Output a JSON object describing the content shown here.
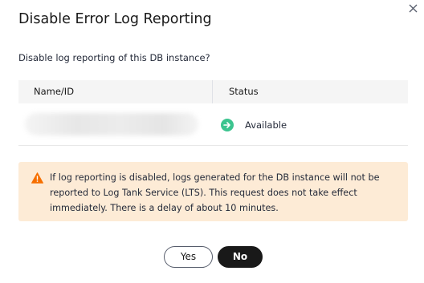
{
  "dialog": {
    "title": "Disable Error Log Reporting",
    "close_icon": "close-icon",
    "question": "Disable log reporting of this DB instance?"
  },
  "table": {
    "columns": [
      "Name/ID",
      "Status"
    ],
    "rows": [
      {
        "name": "",
        "status": "Available",
        "status_icon": "available-arrow-icon"
      }
    ]
  },
  "warning": {
    "icon": "warning-icon",
    "text": "If log reporting is disabled, logs generated for the DB instance will not be reported to Log Tank Service (LTS). This request does not take effect immediately. There is a delay of about 10 minutes."
  },
  "buttons": {
    "yes_label": "Yes",
    "no_label": "No"
  },
  "colors": {
    "warning_bg": "#fdebd6",
    "warning_icon": "#f66f00",
    "status_available": "#3cc48f",
    "primary_button": "#191919"
  }
}
